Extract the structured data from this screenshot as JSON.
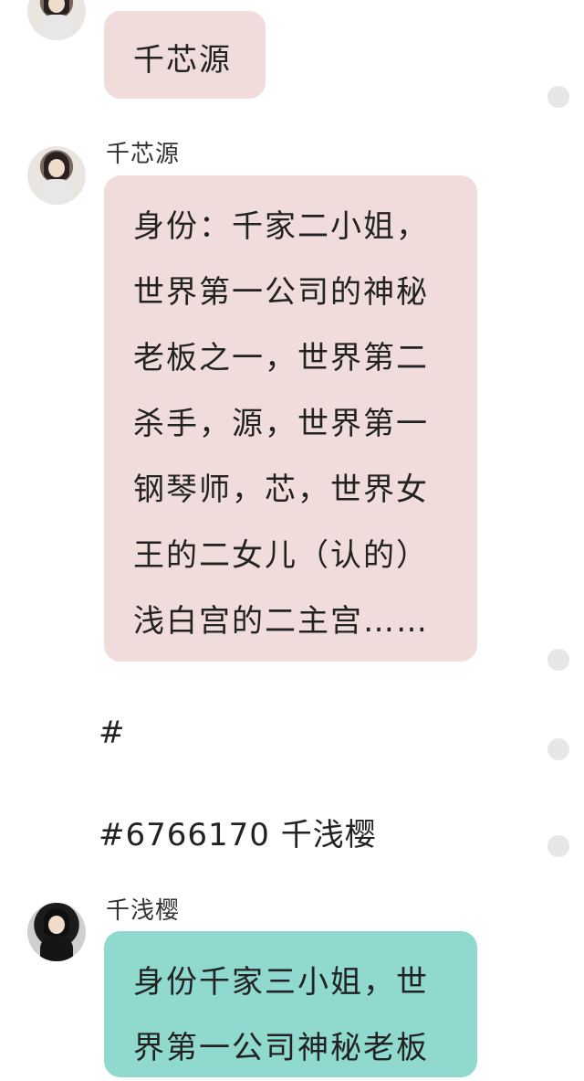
{
  "messages": {
    "m1": {
      "text": "千芯源"
    },
    "m2": {
      "sender": "千芯源",
      "lines": [
        "身份：千家二小姐，",
        "世界第一公司的神秘",
        "老板之一，世界第二",
        "杀手，源，世界第一",
        "钢琴师，芯，世界女",
        "王的二女儿（认的）",
        "浅白宫的二主宫……"
      ]
    },
    "m3": {
      "text": "#"
    },
    "m4": {
      "text": "#6766170 千浅樱"
    },
    "m5": {
      "sender": "千浅樱",
      "lines": [
        "身份千家三小姐，世",
        "界第一公司神秘老板"
      ]
    }
  },
  "icons": {
    "avatar_1": "avatar-icon",
    "avatar_2": "avatar-icon",
    "avatar_3": "avatar-icon",
    "status_dot": "status-dot-icon"
  },
  "colors": {
    "pink_bubble": "#f1dcdc",
    "teal_bubble": "#8fd9cf",
    "background": "#ffffff"
  }
}
